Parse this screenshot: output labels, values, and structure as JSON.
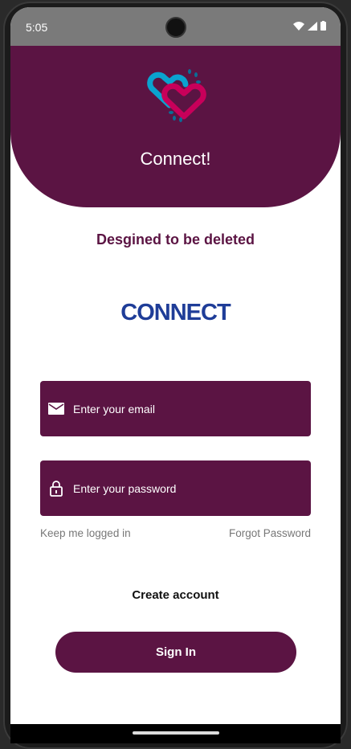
{
  "status_bar": {
    "time": "5:05",
    "icons": [
      "wifi-icon",
      "signal-icon",
      "battery-icon"
    ]
  },
  "header": {
    "title": "Connect!",
    "logo": "hearts-logo"
  },
  "tagline": "Desgined to be deleted",
  "brand_logo": "CONNECT",
  "email": {
    "placeholder": "Enter your email",
    "icon": "email-icon"
  },
  "password": {
    "placeholder": "Enter your password",
    "icon": "lock-icon"
  },
  "keep_logged_in": "Keep me logged in",
  "forgot_password": "Forgot Password",
  "create_account": "Create account",
  "sign_in": "Sign In",
  "colors": {
    "primary": "#5b1443",
    "brand": "#1f3d98",
    "heart_blue": "#0aa3cf",
    "heart_pink": "#c8005a"
  }
}
